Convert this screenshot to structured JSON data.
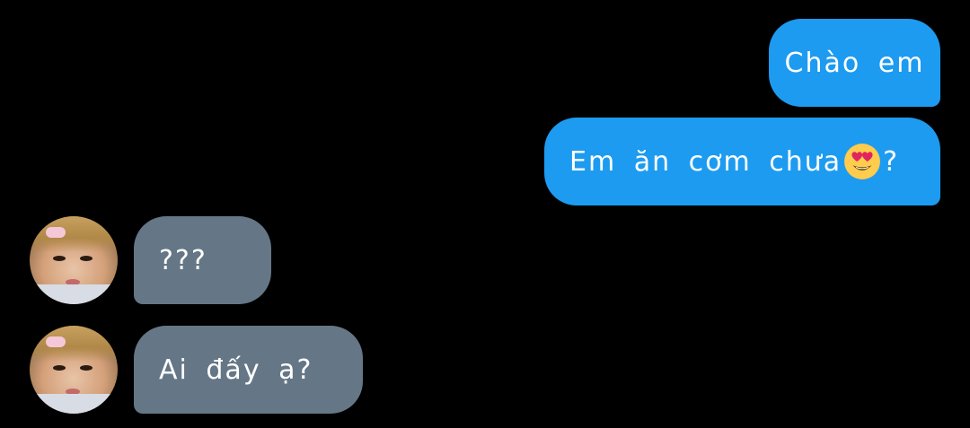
{
  "conversation": {
    "messages": [
      {
        "direction": "sent",
        "text": "Chào em"
      },
      {
        "direction": "sent",
        "text_before_emoji": "Em ăn cơm chưa",
        "emoji": "smiling-face-with-heart-eyes",
        "text_after_emoji": "?"
      },
      {
        "direction": "received",
        "text": "???",
        "avatar": "contact-avatar"
      },
      {
        "direction": "received",
        "text": "Ai đấy ạ?",
        "avatar": "contact-avatar"
      }
    ]
  },
  "colors": {
    "background": "#000000",
    "sent_bubble": "#1d9bf0",
    "received_bubble": "#657786",
    "text": "#ffffff"
  }
}
